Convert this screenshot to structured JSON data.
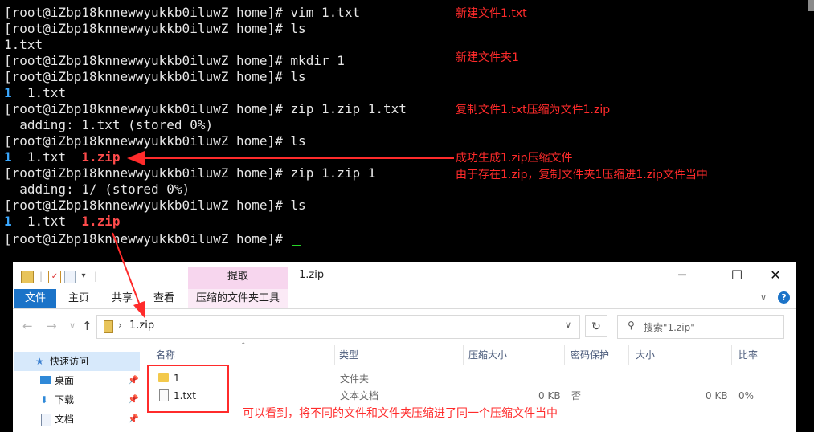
{
  "terminal": {
    "prompt": "[root@iZbp18knnewwyukkb0iluwZ home]# ",
    "lines": [
      {
        "cmd": "vim 1.txt"
      },
      {
        "cmd": "ls"
      },
      {
        "out": "1.txt"
      },
      {
        "cmd": "mkdir 1"
      },
      {
        "cmd": "ls"
      },
      {
        "dir": "1",
        "txt": "1.txt"
      },
      {
        "cmd": "zip 1.zip 1.txt"
      },
      {
        "out": "  adding: 1.txt (stored 0%)"
      },
      {
        "cmd": "ls"
      },
      {
        "dir": "1",
        "txt": "1.txt",
        "zip": "1.zip"
      },
      {
        "cmd": "zip 1.zip 1"
      },
      {
        "out": "  adding: 1/ (stored 0%)"
      },
      {
        "cmd": "ls"
      },
      {
        "dir": "1",
        "txt": "1.txt",
        "zip": "1.zip"
      },
      {
        "cmd": "",
        "cursor": true
      }
    ]
  },
  "annotations": [
    "新建文件1.txt",
    "新建文件夹1",
    "复制文件1.txt压缩为文件1.zip",
    "成功生成1.zip压缩文件",
    "由于存在1.zip，复制文件夹1压缩进1.zip文件当中",
    "可以看到，将不同的文件和文件夹压缩进了同一个压缩文件当中"
  ],
  "explorer": {
    "window_title": "1.zip",
    "context_tab_group": "提取",
    "tabs": [
      "文件",
      "主页",
      "共享",
      "查看",
      "压缩的文件夹工具"
    ],
    "address": "1.zip",
    "search_placeholder": "搜索\"1.zip\"",
    "sidebar": [
      "快速访问",
      "桌面",
      "下载",
      "文档"
    ],
    "columns": [
      "名称",
      "类型",
      "压缩大小",
      "密码保护",
      "大小",
      "比率"
    ],
    "rows": [
      {
        "name": "1",
        "type": "文件夹",
        "compressed": "",
        "password": "",
        "size": "",
        "ratio": ""
      },
      {
        "name": "1.txt",
        "type": "文本文档",
        "compressed": "0 KB",
        "password": "否",
        "size": "0 KB",
        "ratio": "0%"
      }
    ]
  },
  "colors": {
    "annotation": "#ff2b2b",
    "dir": "#3aa8ff",
    "zip": "#ff4b4b",
    "file_tab": "#1b73c8",
    "context_tab": "#f7d6ee"
  }
}
